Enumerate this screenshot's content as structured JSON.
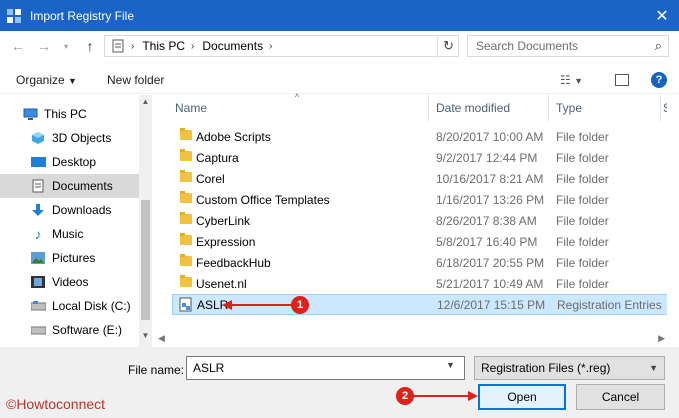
{
  "window": {
    "title": "Import Registry File"
  },
  "address": {
    "crumbs": [
      "This PC",
      "Documents"
    ],
    "search_placeholder": "Search Documents"
  },
  "toolbar": {
    "organize_label": "Organize",
    "new_folder_label": "New folder"
  },
  "nav": {
    "items": [
      {
        "label": "This PC",
        "icon": "computer-icon"
      },
      {
        "label": "3D Objects",
        "icon": "cube-icon"
      },
      {
        "label": "Desktop",
        "icon": "desktop-icon"
      },
      {
        "label": "Documents",
        "icon": "document-icon"
      },
      {
        "label": "Downloads",
        "icon": "download-icon"
      },
      {
        "label": "Music",
        "icon": "music-icon"
      },
      {
        "label": "Pictures",
        "icon": "picture-icon"
      },
      {
        "label": "Videos",
        "icon": "video-icon"
      },
      {
        "label": "Local Disk (C:)",
        "icon": "drive-icon"
      },
      {
        "label": "Software (E:)",
        "icon": "drive-icon"
      }
    ],
    "selected": "Documents"
  },
  "columns": {
    "name": "Name",
    "date": "Date modified",
    "type": "Type",
    "size": "S"
  },
  "files": [
    {
      "name": "Adobe Scripts",
      "date": "8/20/2017 10:00 AM",
      "type": "File folder"
    },
    {
      "name": "Captura",
      "date": "9/2/2017 12:44 PM",
      "type": "File folder"
    },
    {
      "name": "Corel",
      "date": "10/16/2017 8:21 AM",
      "type": "File folder"
    },
    {
      "name": "Custom Office Templates",
      "date": "1/16/2017 13:26 PM",
      "type": "File folder"
    },
    {
      "name": "CyberLink",
      "date": "8/26/2017 8:38 AM",
      "type": "File folder"
    },
    {
      "name": "Expression",
      "date": "5/8/2017 16:40 PM",
      "type": "File folder"
    },
    {
      "name": "FeedbackHub",
      "date": "6/18/2017 20:55 PM",
      "type": "File folder"
    },
    {
      "name": "Usenet.nl",
      "date": "5/21/2017 10:49 AM",
      "type": "File folder"
    },
    {
      "name": "ASLR",
      "date": "12/6/2017 15:15 PM",
      "type": "Registration Entries"
    }
  ],
  "footer": {
    "file_name_label": "File name:",
    "file_name_value": "ASLR",
    "file_type": "Registration Files (*.reg)",
    "open_label": "Open",
    "cancel_label": "Cancel"
  },
  "annotations": {
    "marker1": "1",
    "marker2": "2",
    "color": "#e0201a"
  },
  "watermark": "©Howtoconnect"
}
